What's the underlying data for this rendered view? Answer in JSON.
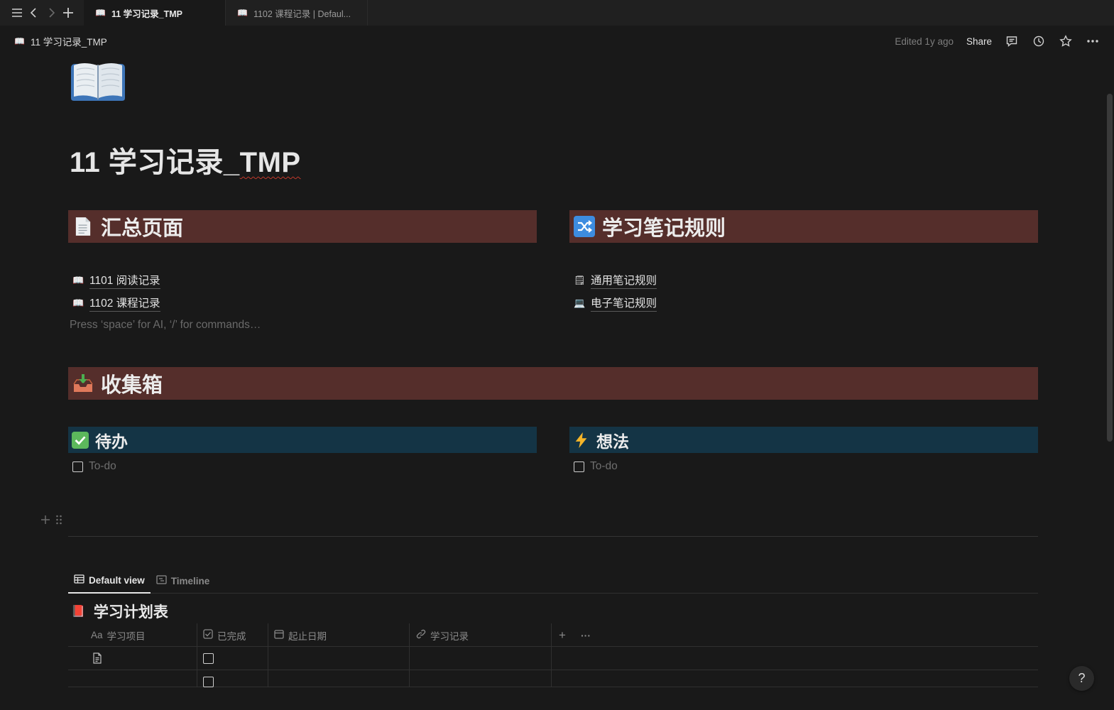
{
  "tabs": [
    {
      "icon": "📖",
      "label": "11 学习记录_TMP",
      "active": true
    },
    {
      "icon": "📖",
      "label": "1102 课程记录 | Defaul...",
      "active": false
    }
  ],
  "topbar": {
    "breadcrumb_icon": "📖",
    "breadcrumb": "11 学习记录_TMP",
    "edited": "Edited 1y ago",
    "share": "Share"
  },
  "page": {
    "title_prefix": "11 学习记录_",
    "title_suffix": "TMP"
  },
  "sections": {
    "summary": {
      "title": "汇总页面",
      "links": [
        {
          "icon": "📖",
          "label": "1101 阅读记录"
        },
        {
          "icon": "📖",
          "label": "1102 课程记录"
        }
      ],
      "placeholder": "Press ‘space’ for AI, ‘/’ for commands…"
    },
    "rules": {
      "title": "学习笔记规则",
      "links": [
        {
          "icon": "🗒",
          "label": "通用笔记规则"
        },
        {
          "icon": "💻",
          "label": "电子笔记规则"
        }
      ]
    },
    "inbox": {
      "title": "收集箱",
      "todo_block": {
        "title": "待办",
        "item": "To-do"
      },
      "ideas_block": {
        "title": "想法",
        "item": "To-do"
      }
    }
  },
  "database": {
    "views": [
      {
        "label": "Default view",
        "icon": "table-icon",
        "active": true
      },
      {
        "label": "Timeline",
        "icon": "timeline-icon",
        "active": false
      }
    ],
    "title_icon": "📕",
    "title": "学习计划表",
    "columns": [
      {
        "prefix": "Aa",
        "label": "学习项目"
      },
      {
        "icon": "checkbox-icon",
        "label": "已完成"
      },
      {
        "icon": "calendar-icon",
        "label": "起止日期"
      },
      {
        "icon": "link-icon",
        "label": "学习记录"
      }
    ],
    "add_column": "+",
    "more": "···"
  },
  "help": "?",
  "colors": {
    "background": "#191919",
    "banner_red": "#552e2b",
    "banner_blue": "#143445",
    "tab_strip": "#202020"
  }
}
